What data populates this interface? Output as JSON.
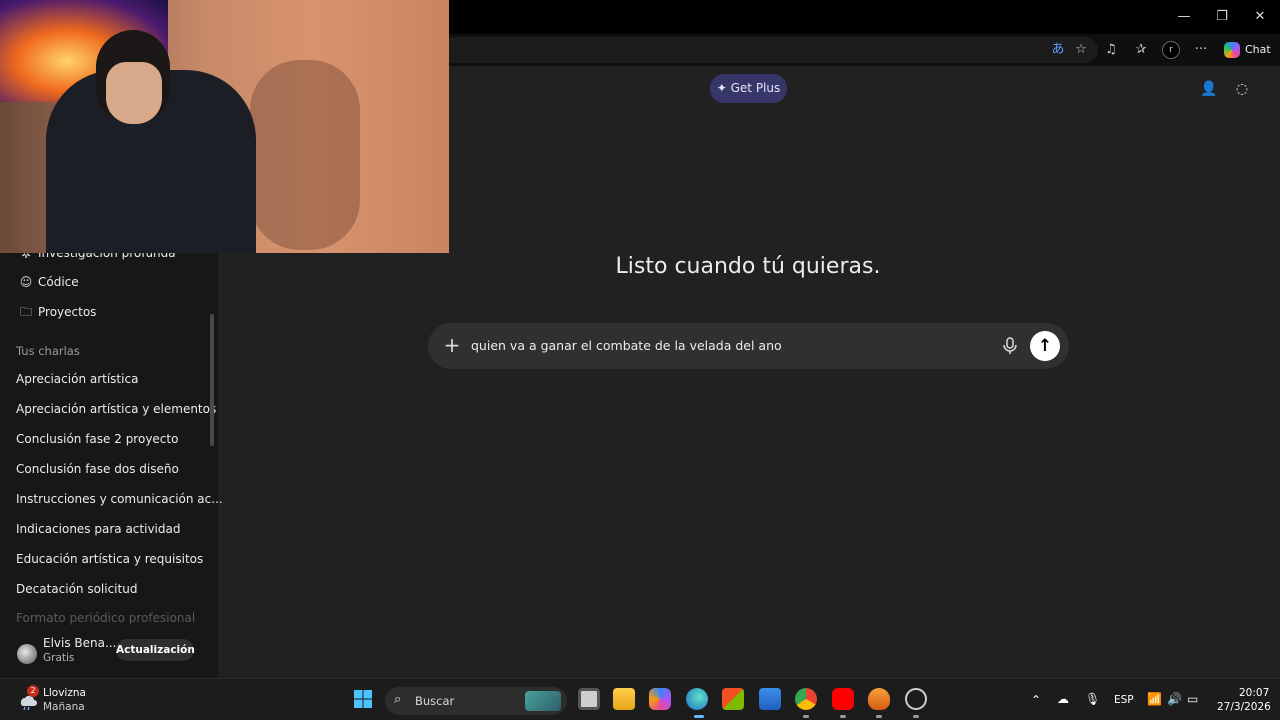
{
  "browser": {
    "chat_label": "Chat",
    "profile_initial": "r"
  },
  "sidebar": {
    "top_items": [
      {
        "label": "Investigación profunda",
        "icon": "telescope-icon"
      },
      {
        "label": "Códice",
        "icon": "codex-icon"
      },
      {
        "label": "Proyectos",
        "icon": "folder-icon"
      }
    ],
    "section_heading": "Tus charlas",
    "chats": [
      "Apreciación artística",
      "Apreciación artística y elementos",
      "Conclusión fase 2 proyecto",
      "Conclusión fase dos diseño",
      "Instrucciones y comunicación ac...",
      "Indicaciones para actividad",
      "Educación artística y requisitos",
      "Decatación solicitud",
      "Formato periódico profesional"
    ],
    "user": {
      "name": "Elvis Bena...",
      "plan": "Gratis",
      "upgrade_label": "Actualización"
    }
  },
  "main": {
    "get_plus_label": "✦ Get Plus",
    "headline": "Listo cuando tú quieras.",
    "composer": {
      "text": "quien va a ganar el combate de la velada del ano"
    }
  },
  "taskbar": {
    "weather": {
      "badge": "2",
      "line1": "Llovizna",
      "line2": "Mañana"
    },
    "search_label": "Buscar",
    "language": "ESP",
    "time": "20:07",
    "date": "27/3/2026"
  },
  "colors": {
    "page_bg": "#212121",
    "sidebar_bg": "#171717",
    "composer_bg": "#303030",
    "get_plus_bg": "#373669"
  }
}
